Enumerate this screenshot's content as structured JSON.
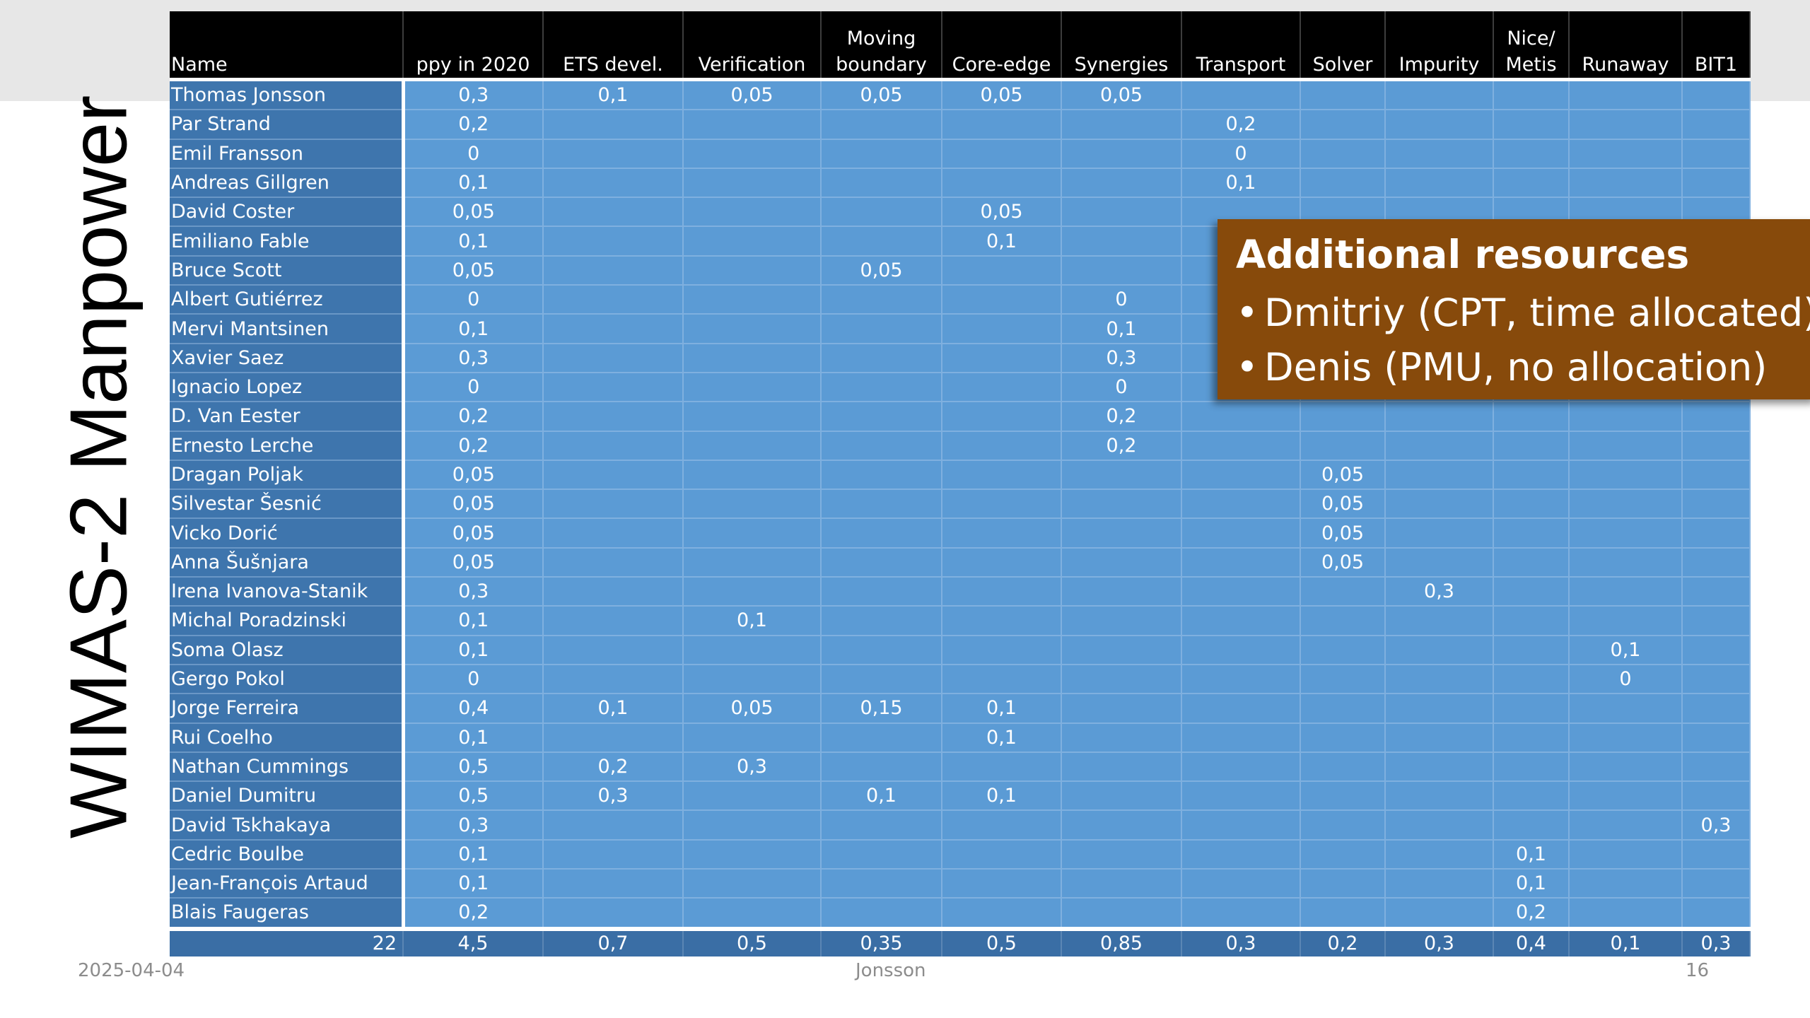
{
  "slide": {
    "title": "WIMAS-2 Manpower",
    "footer": {
      "date": "2025-04-04",
      "author": "Jonsson",
      "page": "16"
    }
  },
  "table": {
    "columns": [
      {
        "line1": "",
        "line2": "Name"
      },
      {
        "line1": "",
        "line2": "ppy in 2020"
      },
      {
        "line1": "",
        "line2": "ETS devel."
      },
      {
        "line1": "",
        "line2": "Verification"
      },
      {
        "line1": "Moving",
        "line2": "boundary"
      },
      {
        "line1": "",
        "line2": "Core-edge"
      },
      {
        "line1": "",
        "line2": "Synergies"
      },
      {
        "line1": "",
        "line2": "Transport"
      },
      {
        "line1": "",
        "line2": "Solver"
      },
      {
        "line1": "",
        "line2": "Impurity"
      },
      {
        "line1": "Nice/",
        "line2": "Metis"
      },
      {
        "line1": "",
        "line2": "Runaway"
      },
      {
        "line1": "",
        "line2": "BIT1"
      }
    ],
    "rows": [
      [
        "Thomas Jonsson",
        "0,3",
        "0,1",
        "0,05",
        "0,05",
        "0,05",
        "0,05",
        "",
        "",
        "",
        "",
        "",
        ""
      ],
      [
        "Par Strand",
        "0,2",
        "",
        "",
        "",
        "",
        "",
        "0,2",
        "",
        "",
        "",
        "",
        ""
      ],
      [
        "Emil Fransson",
        "0",
        "",
        "",
        "",
        "",
        "",
        "0",
        "",
        "",
        "",
        "",
        ""
      ],
      [
        "Andreas Gillgren",
        "0,1",
        "",
        "",
        "",
        "",
        "",
        "0,1",
        "",
        "",
        "",
        "",
        ""
      ],
      [
        "David Coster",
        "0,05",
        "",
        "",
        "",
        "0,05",
        "",
        "",
        "",
        "",
        "",
        "",
        ""
      ],
      [
        "Emiliano Fable",
        "0,1",
        "",
        "",
        "",
        "0,1",
        "",
        "",
        "",
        "",
        "",
        "",
        ""
      ],
      [
        "Bruce Scott",
        "0,05",
        "",
        "",
        "0,05",
        "",
        "",
        "",
        "",
        "",
        "",
        "",
        ""
      ],
      [
        "Albert Gutiérrez",
        "0",
        "",
        "",
        "",
        "",
        "0",
        "",
        "",
        "",
        "",
        "",
        ""
      ],
      [
        "Mervi Mantsinen",
        "0,1",
        "",
        "",
        "",
        "",
        "0,1",
        "",
        "",
        "",
        "",
        "",
        ""
      ],
      [
        "Xavier Saez",
        "0,3",
        "",
        "",
        "",
        "",
        "0,3",
        "",
        "",
        "",
        "",
        "",
        ""
      ],
      [
        "Ignacio Lopez",
        "0",
        "",
        "",
        "",
        "",
        "0",
        "",
        "",
        "",
        "",
        "",
        ""
      ],
      [
        "D. Van Eester",
        "0,2",
        "",
        "",
        "",
        "",
        "0,2",
        "",
        "",
        "",
        "",
        "",
        ""
      ],
      [
        "Ernesto Lerche",
        "0,2",
        "",
        "",
        "",
        "",
        "0,2",
        "",
        "",
        "",
        "",
        "",
        ""
      ],
      [
        "Dragan Poljak",
        "0,05",
        "",
        "",
        "",
        "",
        "",
        "",
        "0,05",
        "",
        "",
        "",
        ""
      ],
      [
        "Silvestar Šesnić",
        "0,05",
        "",
        "",
        "",
        "",
        "",
        "",
        "0,05",
        "",
        "",
        "",
        ""
      ],
      [
        "Vicko Dorić",
        "0,05",
        "",
        "",
        "",
        "",
        "",
        "",
        "0,05",
        "",
        "",
        "",
        ""
      ],
      [
        "Anna Šušnjara",
        "0,05",
        "",
        "",
        "",
        "",
        "",
        "",
        "0,05",
        "",
        "",
        "",
        ""
      ],
      [
        "Irena Ivanova-Stanik",
        "0,3",
        "",
        "",
        "",
        "",
        "",
        "",
        "",
        "0,3",
        "",
        "",
        ""
      ],
      [
        "Michal Poradzinski",
        "0,1",
        "",
        "0,1",
        "",
        "",
        "",
        "",
        "",
        "",
        "",
        "",
        ""
      ],
      [
        "Soma Olasz",
        "0,1",
        "",
        "",
        "",
        "",
        "",
        "",
        "",
        "",
        "",
        "0,1",
        ""
      ],
      [
        "Gergo Pokol",
        "0",
        "",
        "",
        "",
        "",
        "",
        "",
        "",
        "",
        "",
        "0",
        ""
      ],
      [
        "Jorge Ferreira",
        "0,4",
        "0,1",
        "0,05",
        "0,15",
        "0,1",
        "",
        "",
        "",
        "",
        "",
        "",
        ""
      ],
      [
        "Rui Coelho",
        "0,1",
        "",
        "",
        "",
        "0,1",
        "",
        "",
        "",
        "",
        "",
        "",
        ""
      ],
      [
        "Nathan Cummings",
        "0,5",
        "0,2",
        "0,3",
        "",
        "",
        "",
        "",
        "",
        "",
        "",
        "",
        ""
      ],
      [
        "Daniel Dumitru",
        "0,5",
        "0,3",
        "",
        "0,1",
        "0,1",
        "",
        "",
        "",
        "",
        "",
        "",
        ""
      ],
      [
        "David Tskhakaya",
        "0,3",
        "",
        "",
        "",
        "",
        "",
        "",
        "",
        "",
        "",
        "",
        "0,3"
      ],
      [
        "Cedric Boulbe",
        "0,1",
        "",
        "",
        "",
        "",
        "",
        "",
        "",
        "",
        "0,1",
        "",
        ""
      ],
      [
        "Jean-François Artaud",
        "0,1",
        "",
        "",
        "",
        "",
        "",
        "",
        "",
        "",
        "0,1",
        "",
        ""
      ],
      [
        "Blais Faugeras",
        "0,2",
        "",
        "",
        "",
        "",
        "",
        "",
        "",
        "",
        "0,2",
        "",
        ""
      ]
    ],
    "totals": [
      "22",
      "4,5",
      "0,7",
      "0,5",
      "0,35",
      "0,5",
      "0,85",
      "0,3",
      "0,2",
      "0,3",
      "0,4",
      "0,1",
      "0,3"
    ]
  },
  "callout": {
    "title": "Additional resources",
    "items": [
      "Dmitriy (CPT, time allocated)",
      "Denis (PMU, no allocation)"
    ],
    "bullet": "•",
    "color": "#874a0b"
  }
}
